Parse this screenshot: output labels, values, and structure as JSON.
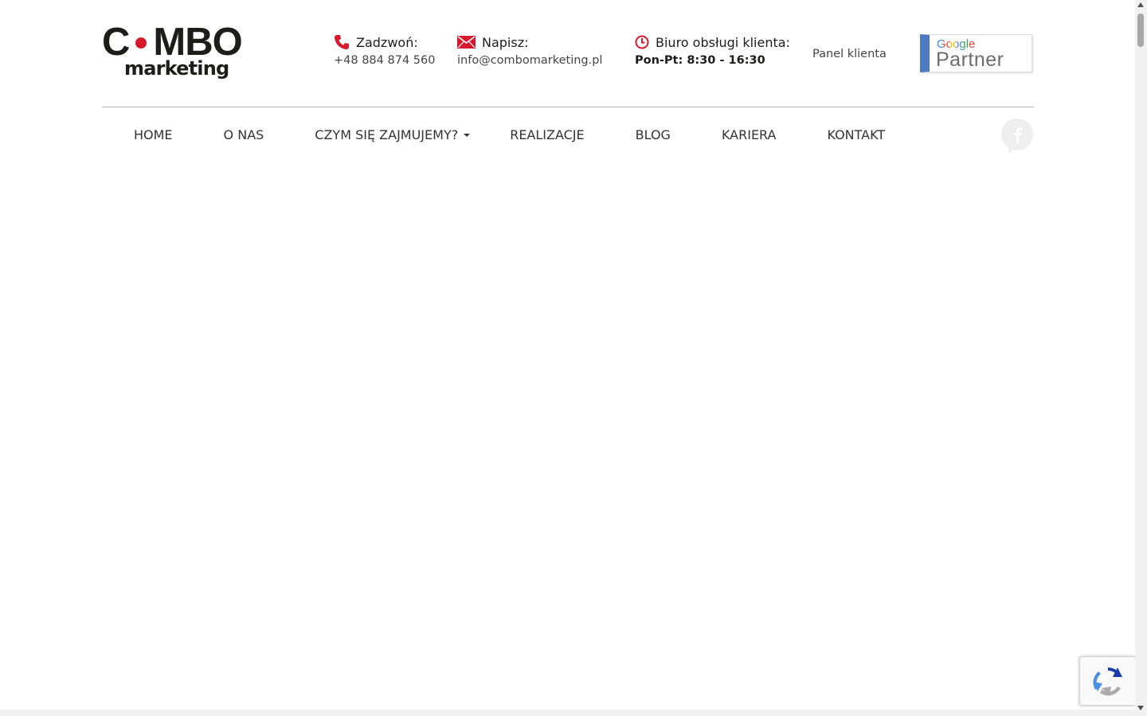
{
  "logo": {
    "combo_prefix": "C",
    "combo_suffix": "MBO",
    "sub": "marketing"
  },
  "contact": {
    "phone": {
      "label": "Zadzwoń:",
      "value": "+48 884 874 560"
    },
    "email": {
      "label": "Napisz:",
      "value": "info@combomarketing.pl"
    },
    "hours": {
      "label": "Biuro obsługi klienta:",
      "value": "Pon-Pt: 8:30 - 16:30"
    }
  },
  "panel_link": "Panel klienta",
  "badge": {
    "google": "Google",
    "partner": "Partner"
  },
  "nav": {
    "items": [
      {
        "label": "HOME"
      },
      {
        "label": "O NAS"
      },
      {
        "label": "CZYM SIĘ ZAJMUJEMY?",
        "dropdown": true
      },
      {
        "label": "REALIZACJE"
      },
      {
        "label": "BLOG"
      },
      {
        "label": "KARIERA"
      },
      {
        "label": "KONTAKT"
      }
    ]
  },
  "colors": {
    "accent": "#d7192d",
    "text": "#333333",
    "badge_blue": "#4c7bc4",
    "divider": "#b5b5b5"
  },
  "icons": [
    "phone-icon",
    "mail-icon",
    "clock-icon",
    "facebook-icon",
    "recaptcha-icon"
  ]
}
